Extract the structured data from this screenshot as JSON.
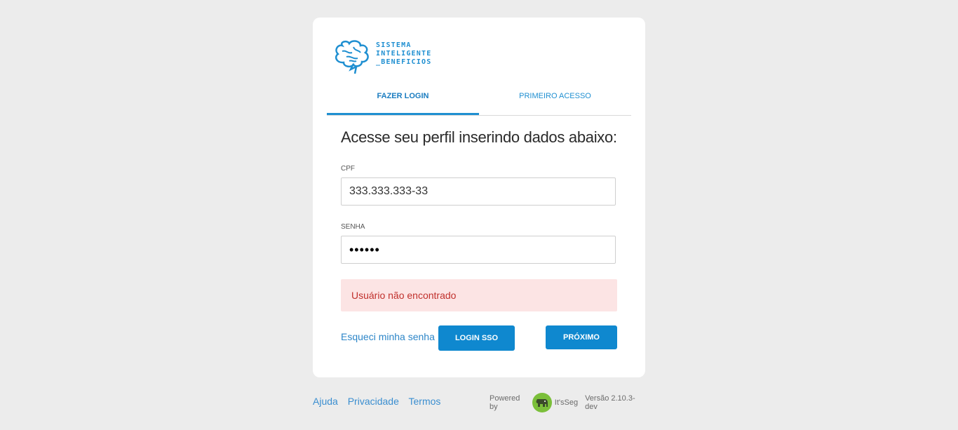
{
  "logo": {
    "lines": [
      "SISTEMA",
      "INTELIGENTE",
      "_BENEFICIOS"
    ],
    "icon": "brain-icon",
    "color": "#1f8fd1"
  },
  "tabs": [
    {
      "label": "FAZER LOGIN",
      "active": true
    },
    {
      "label": "PRIMEIRO ACESSO",
      "active": false
    }
  ],
  "form": {
    "heading": "Acesse seu perfil inserindo dados abaixo:",
    "cpf_label": "CPF",
    "cpf_value": "333.333.333-33",
    "senha_label": "SENHA",
    "senha_value": "••••••",
    "error": "Usuário não encontrado",
    "forgot_link": "Esqueci minha senha",
    "sso_button": "LOGIN SSO",
    "next_button": "PRÓXIMO"
  },
  "footer": {
    "links": [
      "Ajuda",
      "Privacidade",
      "Termos"
    ],
    "powered_by": "Powered by",
    "brand": "It'sSeg",
    "brand_icon": "elephant-icon",
    "version": "Versão 2.10.3-dev"
  },
  "colors": {
    "accent": "#1f8fd1",
    "error_bg": "#fce4e4",
    "error_text": "#c0302c",
    "background": "#ececec"
  }
}
